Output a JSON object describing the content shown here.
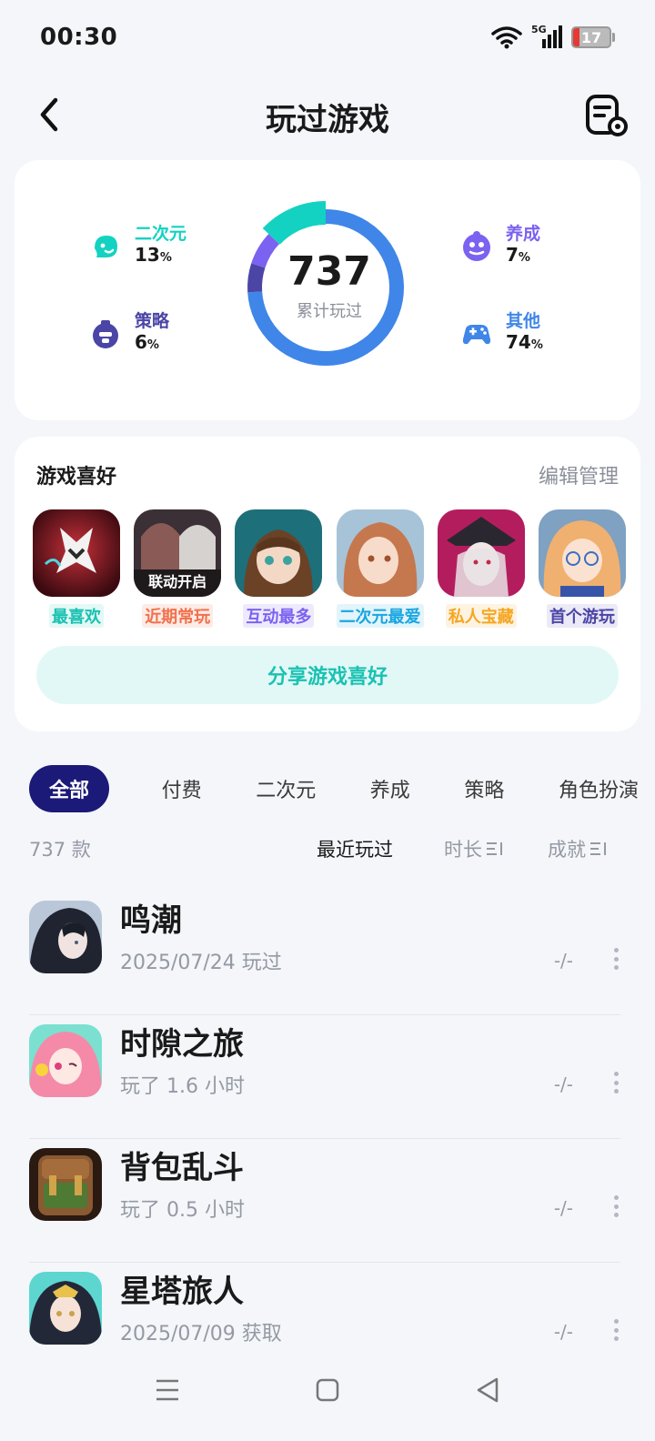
{
  "status_bar": {
    "time": "00:30",
    "network": "5G",
    "battery": "17",
    "battery_level": 0.17
  },
  "header": {
    "title": "玩过游戏",
    "back_icon": "chevron-left-icon",
    "settings_icon": "list-settings-icon"
  },
  "stats": {
    "total": "737",
    "caption": "累计玩过",
    "categories": [
      {
        "label": "二次元",
        "value": "13",
        "unit": "%",
        "color": "#14d2c2",
        "icon": "anime-face-icon"
      },
      {
        "label": "策略",
        "value": "6",
        "unit": "%",
        "color": "#4b45a6",
        "icon": "strategy-icon"
      },
      {
        "label": "养成",
        "value": "7",
        "unit": "%",
        "color": "#7b62f0",
        "icon": "nurture-icon"
      },
      {
        "label": "其他",
        "value": "74",
        "unit": "%",
        "color": "#3f86e8",
        "icon": "gamepad-icon"
      }
    ]
  },
  "favorites": {
    "title": "游戏喜好",
    "edit_label": "编辑管理",
    "games": [
      {
        "label": "最喜欢",
        "label_color": "#19c2b2",
        "label_bg": "#e4f8f5"
      },
      {
        "label": "近期常玩",
        "label_color": "#f2704d",
        "label_bg": "#fdece6",
        "thumb_text": "联动开启"
      },
      {
        "label": "互动最多",
        "label_color": "#7b62f0",
        "label_bg": "#eeeafd"
      },
      {
        "label": "二次元最爱",
        "label_color": "#19a6e0",
        "label_bg": "#e3f4fb"
      },
      {
        "label": "私人宝藏",
        "label_color": "#f5a623",
        "label_bg": "#fdf3e2"
      },
      {
        "label": "首个游玩",
        "label_color": "#4b45a6",
        "label_bg": "#ebeaf6"
      }
    ],
    "share_label": "分享游戏喜好"
  },
  "tabs": [
    "全部",
    "付费",
    "二次元",
    "养成",
    "策略",
    "角色扮演"
  ],
  "sort": {
    "count": "737 款",
    "options": [
      "最近玩过",
      "时长",
      "成就"
    ]
  },
  "games": [
    {
      "name": "鸣潮",
      "sub": "2025/07/24 玩过",
      "score": "-/-"
    },
    {
      "name": "时隙之旅",
      "sub": "玩了 1.6 小时",
      "score": "-/-"
    },
    {
      "name": "背包乱斗",
      "sub": "玩了 0.5 小时",
      "score": "-/-"
    },
    {
      "name": "星塔旅人",
      "sub": "2025/07/09 获取",
      "score": "-/-"
    }
  ]
}
